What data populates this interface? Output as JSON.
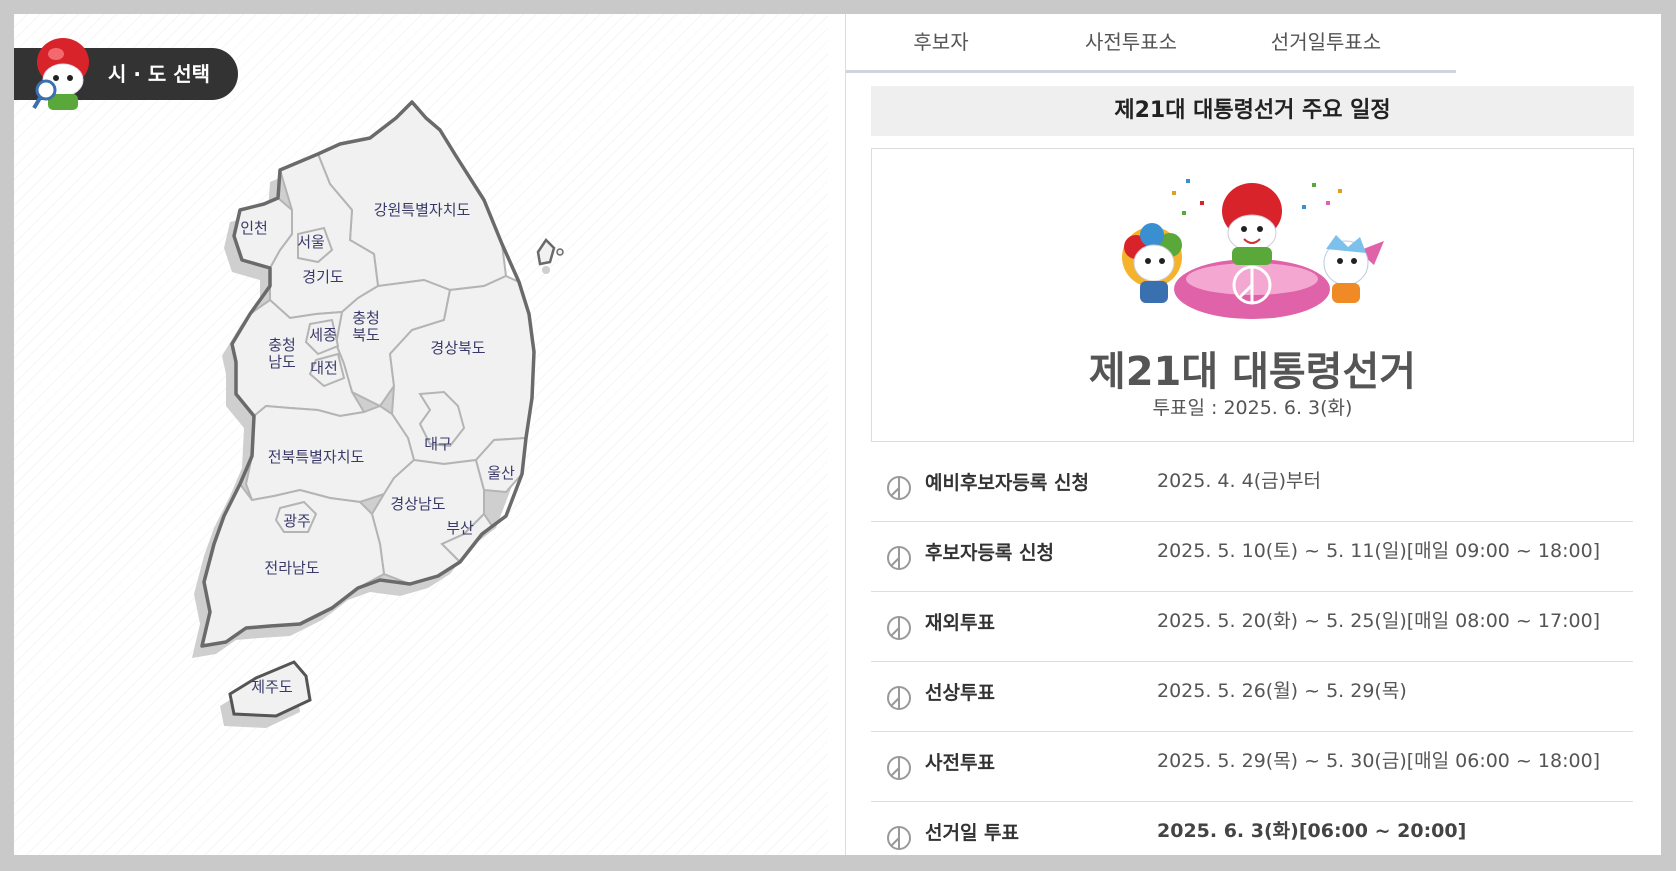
{
  "region_select": {
    "label": "시 · 도 선택"
  },
  "map": {
    "regions": {
      "incheon": "인천",
      "seoul": "서울",
      "gyeonggi": "경기도",
      "gangwon": "강원특별자치도",
      "chungbuk_1": "충청",
      "chungbuk_2": "북도",
      "chungnam_1": "충청",
      "chungnam_2": "남도",
      "sejong": "세종",
      "daejeon": "대전",
      "gyeongbuk": "경상북도",
      "daegu": "대구",
      "jeonbuk": "전북특별자치도",
      "ulsan": "울산",
      "gyeongnam": "경상남도",
      "gwangju": "광주",
      "busan": "부산",
      "jeonnam": "전라남도",
      "jeju": "제주도"
    }
  },
  "tabs": [
    "후보자",
    "사전투표소",
    "선거일투표소"
  ],
  "schedule_title": "제21대 대통령선거 주요 일정",
  "election": {
    "name": "제21대 대통령선거",
    "vote_date": "투표일 : 2025. 6. 3(화)"
  },
  "schedule": [
    {
      "label": "예비후보자등록 신청",
      "date": "2025. 4. 4(금)부터"
    },
    {
      "label": "후보자등록 신청",
      "date": "2025. 5. 10(토) ~ 5. 11(일)[매일 09:00 ~ 18:00]"
    },
    {
      "label": "재외투표",
      "date": "2025. 5. 20(화) ~ 5. 25(일)[매일 08:00 ~ 17:00]"
    },
    {
      "label": "선상투표",
      "date": "2025. 5. 26(월) ~ 5. 29(목)"
    },
    {
      "label": "사전투표",
      "date": "2025. 5. 29(목) ~ 5. 30(금)[매일 06:00 ~ 18:00]"
    },
    {
      "label": "선거일 투표",
      "date": "2025. 6. 3(화)[06:00 ~ 20:00]"
    }
  ],
  "icons": {
    "schedule_item": "ballot-mark-icon",
    "mascot": "election-mascot-icon"
  },
  "colors": {
    "dark_badge": "#333333",
    "mascot_red": "#d8232a",
    "mascot_pink": "#e062a8",
    "tab_underline": "#cfd4e0"
  }
}
